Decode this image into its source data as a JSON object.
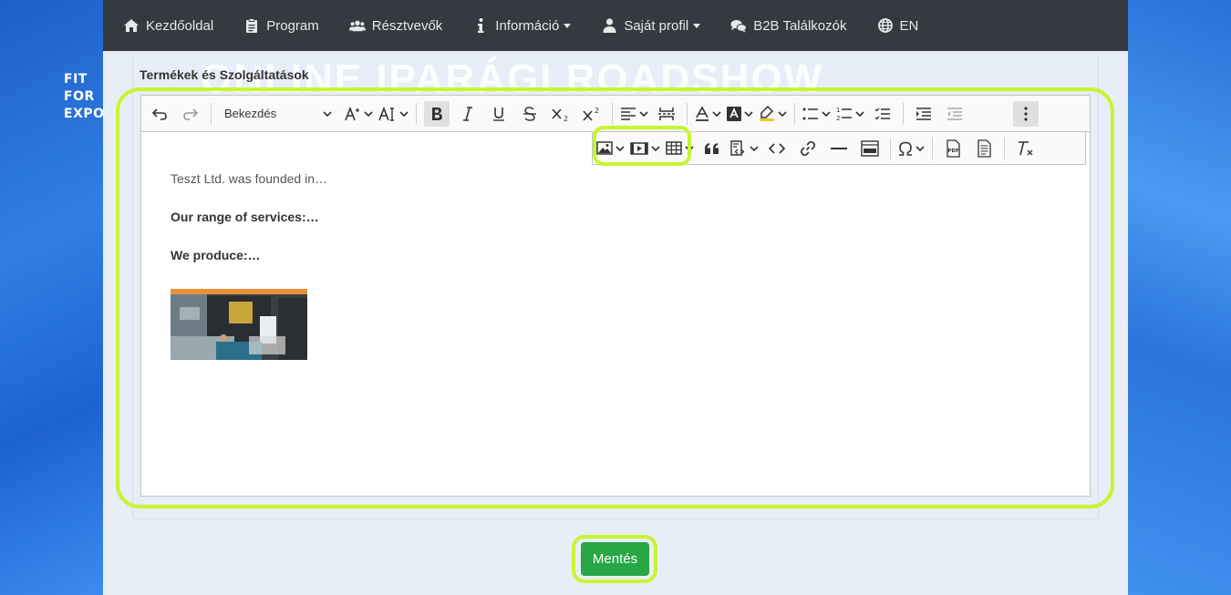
{
  "logo": {
    "lines": [
      "FIT",
      "FOR",
      "EXPORT"
    ]
  },
  "nav": [
    {
      "label": "Kezdőoldal",
      "icon": "home-icon",
      "dropdown": false
    },
    {
      "label": "Program",
      "icon": "clipboard-icon",
      "dropdown": false
    },
    {
      "label": "Résztvevők",
      "icon": "users-icon",
      "dropdown": false
    },
    {
      "label": "Információ",
      "icon": "info-icon",
      "dropdown": true
    },
    {
      "label": "Saját profil",
      "icon": "user-icon",
      "dropdown": true
    },
    {
      "label": "B2B Találkozók",
      "icon": "comments-icon",
      "dropdown": false
    },
    {
      "label": "EN",
      "icon": "globe-icon",
      "dropdown": false
    }
  ],
  "watermark": "ONLINE IPARÁGI ROADSHOW",
  "section": {
    "title": "Termékek és Szolgáltatások"
  },
  "editor": {
    "heading_select": "Bekezdés",
    "paragraphs": {
      "p1": "Teszt Ltd. was founded in…",
      "p2": "Our range of services:…",
      "p3": "We produce:…"
    }
  },
  "save": {
    "label": "Mentés"
  },
  "colors": {
    "navbar": "#343a40",
    "highlight": "#c6f531",
    "save": "#28a745",
    "page": "#e8eef7"
  }
}
